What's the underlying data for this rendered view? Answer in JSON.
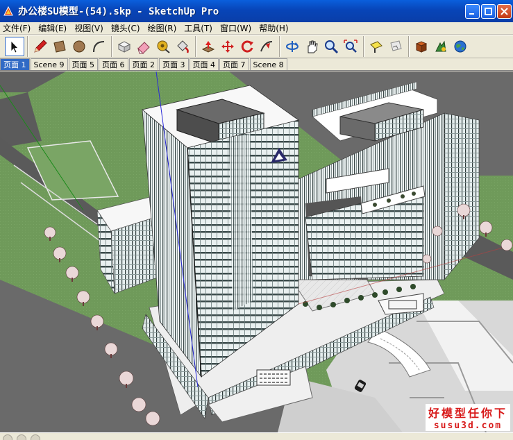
{
  "window": {
    "title": "办公楼SU模型-(54).skp - SketchUp Pro",
    "minimize": "_",
    "maximize": "□",
    "close": "✕"
  },
  "menu": [
    "文件(F)",
    "编辑(E)",
    "视图(V)",
    "镜头(C)",
    "绘图(R)",
    "工具(T)",
    "窗口(W)",
    "帮助(H)"
  ],
  "toolbar": {
    "groups": [
      [
        "select-icon"
      ],
      [
        "pencil-icon",
        "rectangle-icon",
        "circle-icon",
        "arc-icon"
      ],
      [
        "make-component-icon",
        "eraser-icon",
        "tape-measure-icon",
        "paint-bucket-icon"
      ],
      [
        "push-pull-icon",
        "move-icon",
        "rotate-icon",
        "follow-me-icon"
      ],
      [
        "orbit-icon",
        "pan-icon",
        "zoom-icon",
        "zoom-extents-icon"
      ],
      [
        "position-camera-icon",
        "walk-icon"
      ],
      [
        "get-models-icon",
        "share-model-icon",
        "google-earth-icon"
      ]
    ]
  },
  "tabs": [
    "页面 1",
    "Scene 9",
    "页面 5",
    "页面 6",
    "页面 2",
    "页面 3",
    "页面 4",
    "页面 7",
    "Scene 8"
  ],
  "active_tab": 0,
  "watermark": {
    "cn": "好模型任你下",
    "en": "susu3d.com"
  },
  "colors": {
    "title_bar": "#0845b8",
    "ground": "#6f9a5a",
    "road": "#5b5b5b",
    "tower": "#dfe8e8",
    "watermark": "#d81a1a"
  }
}
